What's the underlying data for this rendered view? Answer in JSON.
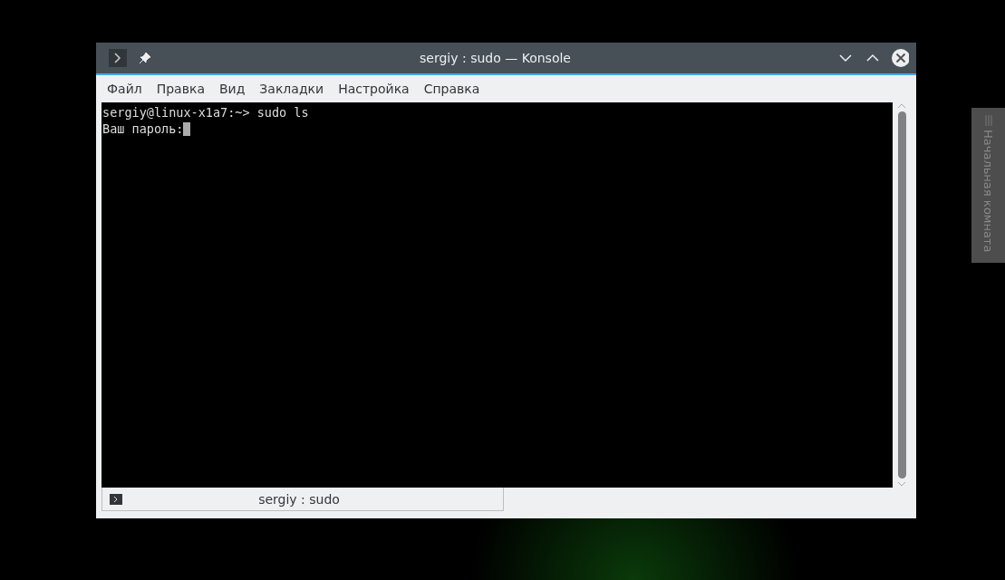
{
  "window": {
    "title": "sergiy : sudo — Konsole"
  },
  "menu": [
    {
      "label": "Файл"
    },
    {
      "label": "Правка"
    },
    {
      "label": "Вид"
    },
    {
      "label": "Закладки"
    },
    {
      "label": "Настройка"
    },
    {
      "label": "Справка"
    }
  ],
  "terminal": {
    "lines": [
      {
        "text": "sergiy@linux-x1a7:~> sudo ls",
        "cursor": false
      },
      {
        "text": "Ваш пароль:",
        "cursor": true
      }
    ]
  },
  "tabs": [
    {
      "label": "sergiy : sudo",
      "selected": true
    }
  ],
  "side_panel": {
    "label": "Начальная комната"
  }
}
